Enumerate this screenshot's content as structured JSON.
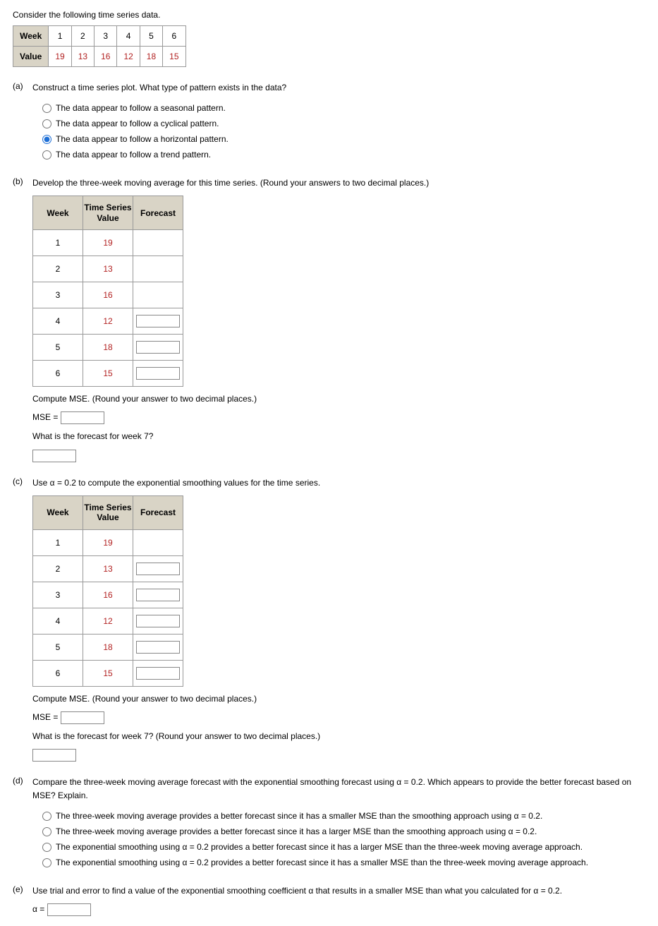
{
  "intro": "Consider the following time series data.",
  "series_table": {
    "row1_label": "Week",
    "row2_label": "Value",
    "weeks": [
      "1",
      "2",
      "3",
      "4",
      "5",
      "6"
    ],
    "values": [
      "19",
      "13",
      "16",
      "12",
      "18",
      "15"
    ]
  },
  "a": {
    "label": "(a)",
    "prompt": "Construct a time series plot. What type of pattern exists in the data?",
    "options": [
      "The data appear to follow a seasonal pattern.",
      "The data appear to follow a cyclical pattern.",
      "The data appear to follow a horizontal pattern.",
      "The data appear to follow a trend pattern."
    ],
    "selected_index": 2
  },
  "b": {
    "label": "(b)",
    "prompt": "Develop the three-week moving average for this time series. (Round your answers to two decimal places.)",
    "headers": [
      "Week",
      "Time Series Value",
      "Forecast"
    ],
    "rows": [
      {
        "w": "1",
        "v": "19",
        "has_input": false
      },
      {
        "w": "2",
        "v": "13",
        "has_input": false
      },
      {
        "w": "3",
        "v": "16",
        "has_input": false
      },
      {
        "w": "4",
        "v": "12",
        "has_input": true
      },
      {
        "w": "5",
        "v": "18",
        "has_input": true
      },
      {
        "w": "6",
        "v": "15",
        "has_input": true
      }
    ],
    "mse_prompt": "Compute MSE. (Round your answer to two decimal places.)",
    "mse_label": "MSE =",
    "forecast_prompt": "What is the forecast for week 7?"
  },
  "c": {
    "label": "(c)",
    "prompt": "Use α = 0.2 to compute the exponential smoothing values for the time series.",
    "headers": [
      "Week",
      "Time Series Value",
      "Forecast"
    ],
    "rows": [
      {
        "w": "1",
        "v": "19",
        "has_input": false
      },
      {
        "w": "2",
        "v": "13",
        "has_input": true
      },
      {
        "w": "3",
        "v": "16",
        "has_input": true
      },
      {
        "w": "4",
        "v": "12",
        "has_input": true
      },
      {
        "w": "5",
        "v": "18",
        "has_input": true
      },
      {
        "w": "6",
        "v": "15",
        "has_input": true
      }
    ],
    "mse_prompt": "Compute MSE. (Round your answer to two decimal places.)",
    "mse_label": "MSE =",
    "forecast_prompt": "What is the forecast for week 7? (Round your answer to two decimal places.)"
  },
  "d": {
    "label": "(d)",
    "prompt": "Compare the three-week moving average forecast with the exponential smoothing forecast using α = 0.2. Which appears to provide the better forecast based on MSE? Explain.",
    "options": [
      "The three-week moving average provides a better forecast since it has a smaller MSE than the smoothing approach using α = 0.2.",
      "The three-week moving average provides a better forecast since it has a larger MSE than the smoothing approach using α = 0.2.",
      "The exponential smoothing using α = 0.2 provides a better forecast since it has a larger MSE than the three-week moving average approach.",
      "The exponential smoothing using α = 0.2 provides a better forecast since it has a smaller MSE than the three-week moving average approach."
    ]
  },
  "e": {
    "label": "(e)",
    "prompt": "Use trial and error to find a value of the exponential smoothing coefficient α that results in a smaller MSE than what you calculated for α = 0.2.",
    "alpha_label": "α ="
  }
}
